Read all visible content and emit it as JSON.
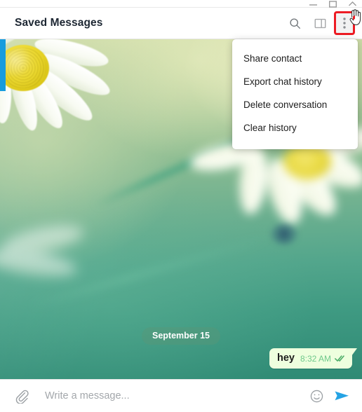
{
  "window": {
    "controls": [
      {
        "name": "minimize",
        "glyph": "minimize-icon"
      },
      {
        "name": "maximize",
        "glyph": "maximize-icon"
      },
      {
        "name": "close",
        "glyph": "close-icon"
      }
    ]
  },
  "header": {
    "title": "Saved Messages",
    "actions": [
      {
        "name": "search-icon",
        "label": "Search"
      },
      {
        "name": "panel-icon",
        "label": "Toggle info panel"
      },
      {
        "name": "more-icon",
        "label": "More options",
        "highlighted": true
      }
    ],
    "highlight_color": "#ed1c24"
  },
  "menu": {
    "visible": true,
    "items": [
      {
        "label": "Share contact",
        "name": "share-contact"
      },
      {
        "label": "Export chat history",
        "name": "export-chat-history"
      },
      {
        "label": "Delete conversation",
        "name": "delete-conversation"
      },
      {
        "label": "Clear history",
        "name": "clear-history"
      }
    ]
  },
  "chat": {
    "date_divider": "September 15",
    "messages": [
      {
        "text": "hey",
        "time": "8:32 AM",
        "outgoing": true,
        "status": "read",
        "status_icon": "double-check-icon",
        "bubble_color": "#eeffde",
        "time_color": "#6fc98b"
      }
    ]
  },
  "composer": {
    "attach_icon": "paperclip-icon",
    "placeholder": "Write a message...",
    "value": "",
    "emoji_icon": "smiley-icon",
    "send_icon": "send-icon",
    "send_color": "#25a3e4"
  },
  "colors": {
    "accent": "#179cde",
    "send": "#25a3e4",
    "highlight": "#ed1c24",
    "bubble": "#eeffde",
    "header_text": "#1d2733"
  }
}
